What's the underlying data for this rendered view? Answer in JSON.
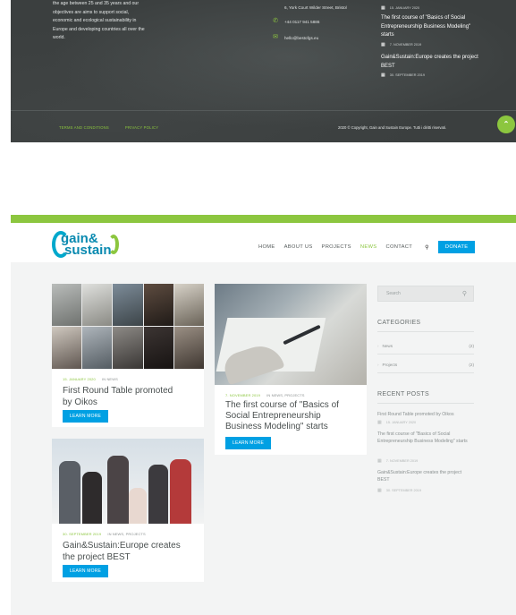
{
  "footer": {
    "about_lines": [
      "the age between 25 and 35 years and our",
      "objectives are aims to support social,",
      "economic and ecological sustainability in",
      "Europe and developing countries all over the",
      "world."
    ],
    "address": "6, York Court Wilder Street, Bristol",
    "phone": "+44 0117 941 5886",
    "email": "hello@bestofgs.eu",
    "posts": [
      {
        "title": "The first course of \"Basics of Social Entrepreneurship Business Modeling\" starts",
        "date": "7. NOVEMBER 2019"
      },
      {
        "title": "Gain&Sustain:Europe creates the project BEST",
        "date": "30. SEPTEMBER 2019"
      }
    ],
    "top_post_date": "15. JANUARY 2020",
    "links": [
      "TERMS AND CONDITIONS",
      "PRIVACY POLICY"
    ],
    "copyright": "2020 © Copyright, Gain and Sustain Europe. Tutti i diritti riservati."
  },
  "header": {
    "logo_line1": "gain&",
    "logo_line2": "sustain",
    "nav": [
      "HOME",
      "ABOUT US",
      "PROJECTS",
      "NEWS",
      "CONTACT"
    ],
    "active_nav": "NEWS",
    "donate_label": "DONATE"
  },
  "posts": [
    {
      "date": "15. JANUARY 2020",
      "categories": "IN NEWS",
      "title_l1": "First Round Table promoted",
      "title_l2": "by Oikos",
      "cta": "LEARN MORE"
    },
    {
      "date": "7. NOVEMBER 2019",
      "categories": "IN NEWS, PROJECTS",
      "title_l1": "The first course of \"Basics of",
      "title_l2": "Social Entrepreneurship",
      "title_l3": "Business Modeling\" starts",
      "cta": "LEARN MORE"
    },
    {
      "date": "30. SEPTEMBER 2019",
      "categories": "IN NEWS, PROJECTS",
      "title_l1": "Gain&Sustain:Europe creates",
      "title_l2": "the project BEST",
      "cta": "LEARN MORE"
    }
  ],
  "sidebar": {
    "search_placeholder": "Search",
    "categories_heading": "CATEGORIES",
    "categories": [
      {
        "label": "News",
        "count": "(2)"
      },
      {
        "label": "Projects",
        "count": "(2)"
      }
    ],
    "recent_heading": "RECENT POSTS",
    "recent": [
      {
        "title": "First Round Table promoted by Oikos",
        "date": "15. JANUARY 2020"
      },
      {
        "title": "The first course of \"Basics of Social Entrepreneurship Business Modeling\" starts",
        "date": "7. NOVEMBER 2019"
      },
      {
        "title": "Gain&Sustain:Europe creates the project BEST",
        "date": "30. SEPTEMBER 2019"
      }
    ]
  },
  "colors": {
    "accent_green": "#8cc63f",
    "button_blue": "#00a0e3",
    "footer_bg": "#3b3f3f"
  }
}
